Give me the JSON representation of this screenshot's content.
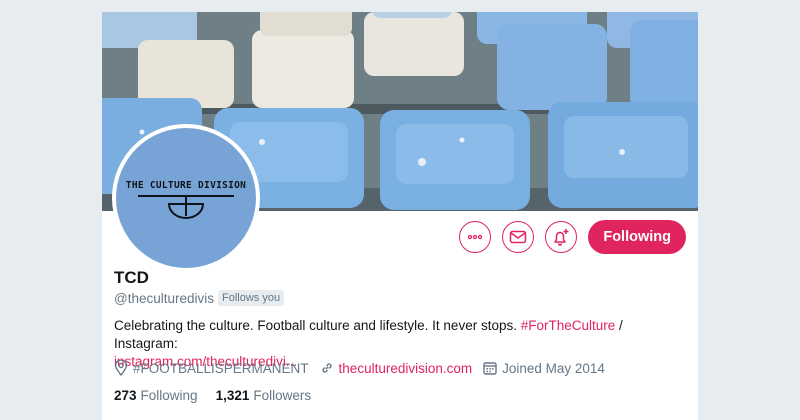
{
  "profile": {
    "name": "TCD",
    "handle": "@theculturedivis",
    "follows_you": "Follows you",
    "avatar_text": "THE CULTURE DIVISION",
    "bio": {
      "text_1": "Celebrating the culture. Football culture and lifestyle. It never stops.",
      "hashtag": "#ForTheCulture",
      "text_2": " / Instagram:",
      "link": "instagram.com/theculturedivi..."
    },
    "location": "#FOOTBALLISPERMANENT",
    "website": "theculturedivision.com",
    "joined": "Joined May 2014",
    "following_count": "273",
    "following_label": "Following",
    "followers_count": "1,321",
    "followers_label": "Followers"
  },
  "actions": {
    "follow_label": "Following",
    "more_icon": "more-icon",
    "message_icon": "envelope-icon",
    "notify_icon": "bell-plus-icon"
  },
  "theme": {
    "accent": "#e0245e",
    "avatar_bg": "#78a3d6",
    "muted_text": "#657786",
    "text": "#14171a"
  }
}
